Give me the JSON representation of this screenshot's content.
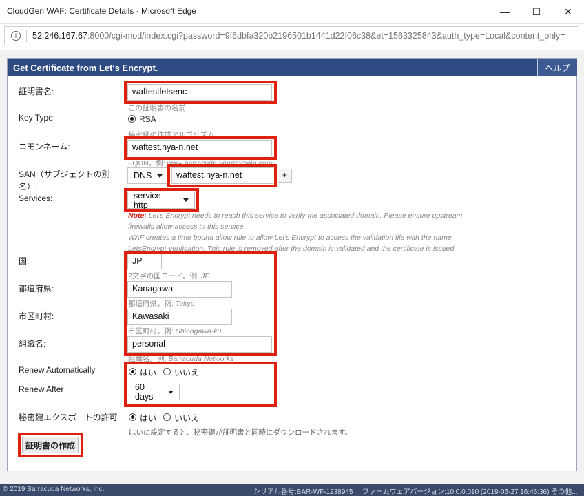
{
  "window": {
    "title": "CloudGen WAF: Certificate Details - Microsoft Edge",
    "minimize": "—",
    "maximize": "☐",
    "close": "✕"
  },
  "address": {
    "host": "52.246.167.67",
    "rest": ":8000/cgi-mod/index.cgi?password=9f6dbfa320b2196501b1441d22f06c38&et=1563325843&auth_type=Local&content_only="
  },
  "panel": {
    "title": "Get Certificate from Let's Encrypt.",
    "help": "ヘルプ"
  },
  "form": {
    "cert_name": {
      "label": "証明書名:",
      "value": "waftestletsenc",
      "hint": "この証明書の名前"
    },
    "key_type": {
      "label": "Key Type:",
      "option": "RSA",
      "hint": "秘密鍵の作成アルゴリズム"
    },
    "common_name": {
      "label": "コモンネーム:",
      "value": "waftest.nya-n.net",
      "hint": "FQDN。例: www.barracuda.yourdomain.com"
    },
    "san": {
      "label_line1": "SAN（サブジェクトの別",
      "label_line2": "名）:",
      "type": "DNS",
      "value": "waftest.nya-n.net",
      "add": "+"
    },
    "services": {
      "label": "Services:",
      "value": "service-http"
    },
    "note": {
      "prefix": "Note:",
      "line1": " Let's Encrypt needs to reach this service to verify the associated domain. Please ensure upstream",
      "line2": "firewalls allow access to this service.",
      "line3": "WAF creates a time bound allow rule to allow Let's Encrypt to access the validation file with the name",
      "line4": "LetsEncrypt-verification. This rule is removed after the domain is validated and the certificate is issued."
    },
    "country": {
      "label": "国:",
      "value": "JP",
      "hint": "2文字の国コード。例: ",
      "hint_example": "JP"
    },
    "state": {
      "label": "都道府県:",
      "value": "Kanagawa",
      "hint": "都道府県。例: ",
      "hint_example": "Tokyo"
    },
    "city": {
      "label": "市区町村:",
      "value": "Kawasaki",
      "hint": "市区町村。例: ",
      "hint_example": "Shinagawa-ku"
    },
    "org": {
      "label": "組織名:",
      "value": "personal",
      "hint": "組織名。例: ",
      "hint_example": "Barracuda Networks"
    },
    "renew_auto": {
      "label": "Renew Automatically",
      "yes": "はい",
      "no": "いいえ",
      "selected": "yes"
    },
    "renew_after": {
      "label": "Renew After",
      "value": "60 days"
    },
    "export_key": {
      "label": "秘密鍵エクスポートの許可",
      "yes": "はい",
      "no": "いいえ",
      "selected": "yes",
      "hint": "はいに設定すると、秘密鍵が証明書と同時にダウンロードされます。"
    },
    "submit": "証明書の作成"
  },
  "footer": {
    "copyright": "© 2019 Barracuda Networks, Inc.",
    "serial": "シリアル番号:BAR-WF-1238945",
    "firmware": "ファームウェアバージョン:10.0.0.010 (2019-05-27 16:46:36) その他..."
  },
  "colors": {
    "header": "#2f4b83",
    "highlight": "#e0200e",
    "footer": "#3a4a6b"
  }
}
